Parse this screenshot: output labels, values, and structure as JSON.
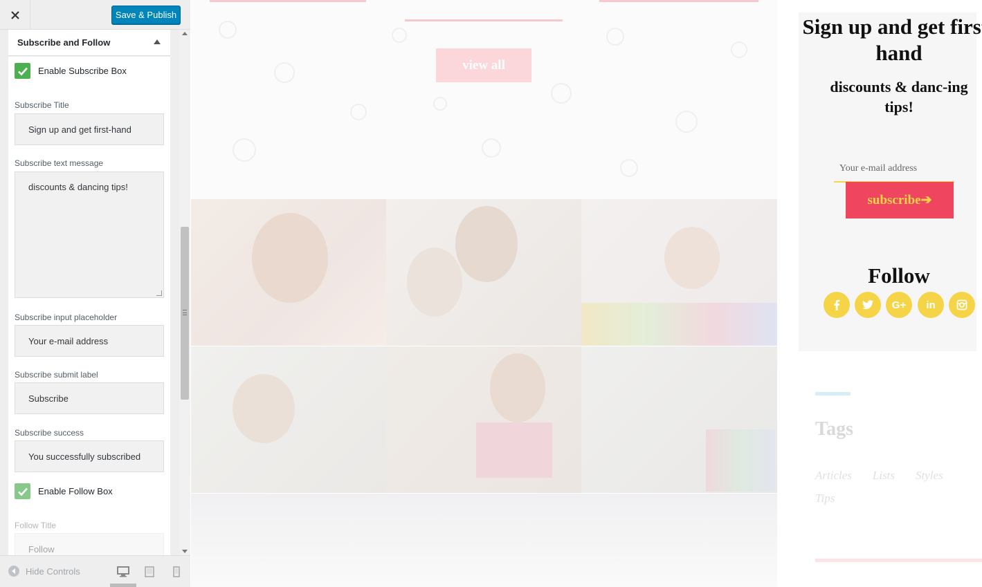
{
  "panel": {
    "save_label": "Save & Publish",
    "section_title": "Subscribe and Follow",
    "enable_subscribe_label": "Enable Subscribe Box",
    "subscribe_title_label": "Subscribe Title",
    "subscribe_title_value": "Sign up and get first-hand",
    "subscribe_text_label": "Subscribe text message",
    "subscribe_text_value": "discounts & dancing tips!",
    "input_placeholder_label": "Subscribe input placeholder",
    "input_placeholder_value": "Your e-mail address",
    "submit_label_label": "Subscribe submit label",
    "submit_label_value": "Subscribe",
    "success_label": "Subscribe success",
    "success_value": "You successfully subscribed",
    "enable_follow_label": "Enable Follow Box",
    "follow_title_label": "Follow Title",
    "follow_title_value": "Follow",
    "hide_controls_label": "Hide Controls"
  },
  "preview": {
    "view_all_label": "view all",
    "subscribe": {
      "title": "Sign up and get first-hand",
      "message": "discounts & danc-ing tips!",
      "placeholder": "Your e-mail address",
      "button_label": "subscribe➔"
    },
    "follow": {
      "title": "Follow",
      "social": [
        "facebook-icon",
        "twitter-icon",
        "google-plus-icon",
        "linkedin-icon",
        "instagram-icon"
      ]
    },
    "tags": {
      "title": "Tags",
      "items": [
        "Articles",
        "Lists",
        "Styles",
        "Tips"
      ]
    }
  },
  "colors": {
    "accent_blue": "#0085ba",
    "checkbox_green": "#4caf50",
    "button_red": "#f0455e",
    "social_yellow": "#f5d547",
    "view_all_pink": "#fbd7dc"
  }
}
